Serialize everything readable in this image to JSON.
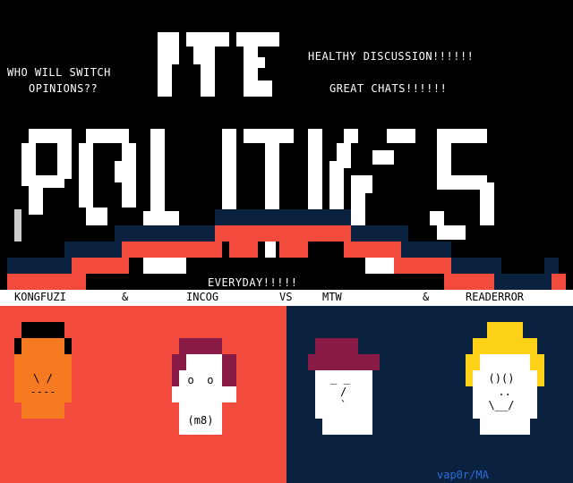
{
  "logo": {
    "word1": "ITE",
    "word2": "POLITICS"
  },
  "captions": {
    "left_line1": "WHO WILL SWITCH",
    "left_line2": "OPINIONS??",
    "right_line1": "HEALTHY DISCUSSION!!!!!!",
    "right_line2": "GREAT CHATS!!!!!!",
    "tagline": "EVERYDAY!!!!!"
  },
  "participants": {
    "p1": "KONGFUZI",
    "amp1": "&",
    "p2": "INCOG",
    "vs": "VS",
    "p3": "MTW",
    "amp2": "&",
    "p4": "READERROR"
  },
  "faces": {
    "kongfuzi": "\\ /\n----",
    "incog": "o  o\n\n\n(m8)",
    "mtw": "_ _\n /\n `",
    "readerror": "()()\n ..\n\\__/"
  },
  "signature": "vap0r/MA",
  "colors": {
    "black": "#000000",
    "white": "#ffffff",
    "red": "#f24a3c",
    "navy": "#0b2140",
    "orange": "#f57a22",
    "maroon": "#8a1a46",
    "yellow": "#ffd21a",
    "grey": "#cccccc"
  }
}
